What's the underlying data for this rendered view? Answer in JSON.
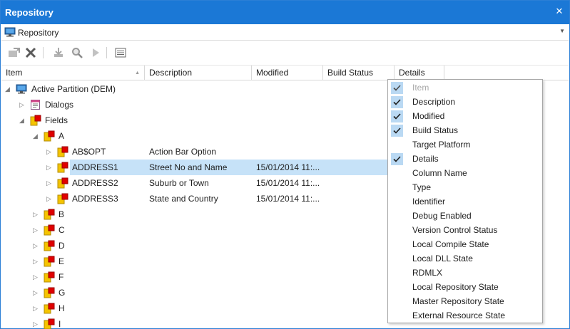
{
  "window": {
    "title": "Repository",
    "close_glyph": "✕"
  },
  "selector": {
    "value": "Repository",
    "icon": "monitor-icon"
  },
  "toolbar": {
    "buttons": [
      {
        "name": "open-button",
        "icon": "open-icon"
      },
      {
        "name": "delete-button",
        "icon": "delete-x-icon"
      },
      {
        "name": "check-in-button",
        "icon": "check-in-icon"
      },
      {
        "name": "find-button",
        "icon": "magnifier-icon"
      },
      {
        "name": "run-button",
        "icon": "play-icon"
      },
      {
        "name": "properties-button",
        "icon": "list-icon"
      }
    ]
  },
  "columns": {
    "item": "Item",
    "description": "Description",
    "modified": "Modified",
    "build_status": "Build Status",
    "details": "Details"
  },
  "tree": {
    "root": {
      "label": "Active Partition (DEM)",
      "expander": "◢"
    },
    "dialogs": {
      "label": "Dialogs",
      "expander": "▷"
    },
    "fields": {
      "label": "Fields",
      "expander": "◢"
    },
    "group_a": {
      "label": "A",
      "expander": "◢"
    },
    "fields_a": [
      {
        "item": "AB$OPT",
        "description": "Action Bar Option",
        "modified": "",
        "expander": "▷"
      },
      {
        "item": "ADDRESS1",
        "description": "Street No and Name",
        "modified": "15/01/2014 11:...",
        "expander": "▷"
      },
      {
        "item": "ADDRESS2",
        "description": "Suburb or Town",
        "modified": "15/01/2014 11:...",
        "expander": "▷"
      },
      {
        "item": "ADDRESS3",
        "description": "State and Country",
        "modified": "15/01/2014 11:...",
        "expander": "▷"
      }
    ],
    "groups": [
      {
        "label": "B",
        "expander": "▷"
      },
      {
        "label": "C",
        "expander": "▷"
      },
      {
        "label": "D",
        "expander": "▷"
      },
      {
        "label": "E",
        "expander": "▷"
      },
      {
        "label": "F",
        "expander": "▷"
      },
      {
        "label": "G",
        "expander": "▷"
      },
      {
        "label": "H",
        "expander": "▷"
      },
      {
        "label": "I",
        "expander": "▷"
      }
    ]
  },
  "column_menu": {
    "items": [
      {
        "label": "Item",
        "checked": true,
        "disabled": true
      },
      {
        "label": "Description",
        "checked": true,
        "disabled": false
      },
      {
        "label": "Modified",
        "checked": true,
        "disabled": false
      },
      {
        "label": "Build Status",
        "checked": true,
        "disabled": false
      },
      {
        "label": "Target Platform",
        "checked": false,
        "disabled": false
      },
      {
        "label": "Details",
        "checked": true,
        "disabled": false
      },
      {
        "label": "Column Name",
        "checked": false,
        "disabled": false
      },
      {
        "label": "Type",
        "checked": false,
        "disabled": false
      },
      {
        "label": "Identifier",
        "checked": false,
        "disabled": false
      },
      {
        "label": "Debug Enabled",
        "checked": false,
        "disabled": false
      },
      {
        "label": "Version Control Status",
        "checked": false,
        "disabled": false
      },
      {
        "label": "Local Compile State",
        "checked": false,
        "disabled": false
      },
      {
        "label": "Local DLL State",
        "checked": false,
        "disabled": false
      },
      {
        "label": "RDMLX",
        "checked": false,
        "disabled": false
      },
      {
        "label": "Local Repository State",
        "checked": false,
        "disabled": false
      },
      {
        "label": "Master Repository State",
        "checked": false,
        "disabled": false
      },
      {
        "label": "External Resource State",
        "checked": false,
        "disabled": false
      }
    ]
  },
  "colors": {
    "titlebar": "#1b78d6",
    "selection": "#c6e2f8",
    "check_bg": "#bad9f3",
    "field_icon_yellow": "#f5c400",
    "field_icon_red": "#e00000"
  }
}
